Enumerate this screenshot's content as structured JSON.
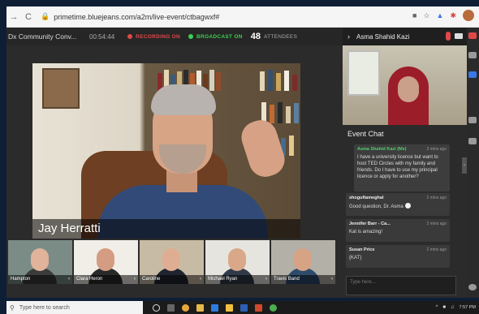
{
  "browser": {
    "url": "primetime.bluejeans.com/a2m/live-event/ctbagwxf#",
    "nav_back": "→",
    "nav_reload": "C"
  },
  "status": {
    "event_name": "Dx Community Conv...",
    "timer": "00:54:44",
    "recording": "RECORDING ON",
    "broadcast": "BROADCAST ON",
    "attendee_count": "48",
    "attendee_label": "ATTENDEES"
  },
  "speaker": {
    "name": "Jay Herratti"
  },
  "thumbnails": [
    {
      "name": "Hampton"
    },
    {
      "name": "Clara Heron"
    },
    {
      "name": "Caroline"
    },
    {
      "name": "Michael Ryan"
    },
    {
      "name": "Travis Band"
    }
  ],
  "right_panel": {
    "presenter": "Asma Shahid Kazi",
    "chat_title": "Event Chat",
    "messages": [
      {
        "name": "Asma Shahid Kazi (Me)",
        "time": "3 mins ago",
        "text": "I have a university licence but want to host TED Circles with my family and friends. Do I have to use my principal licence or apply for another?"
      },
      {
        "name": "shoguftameghal",
        "time": "2 mins ago",
        "text": "Good question, Dr. Asma"
      },
      {
        "name": "Jennifer Barr - Ca...",
        "time": "2 mins ago",
        "text": "Kat is amazing!"
      },
      {
        "name": "Susan Price",
        "time": "2 mins ago",
        "text": "{KAT}"
      }
    ],
    "chat_placeholder": "Type here..."
  },
  "taskbar": {
    "search_placeholder": "Type here to search",
    "time": "7:57 PM"
  },
  "colors": {
    "recording": "#e04848",
    "broadcast": "#3ccf4e",
    "self_name": "#4fcf6a",
    "frame_bg": "#0d1e35"
  }
}
